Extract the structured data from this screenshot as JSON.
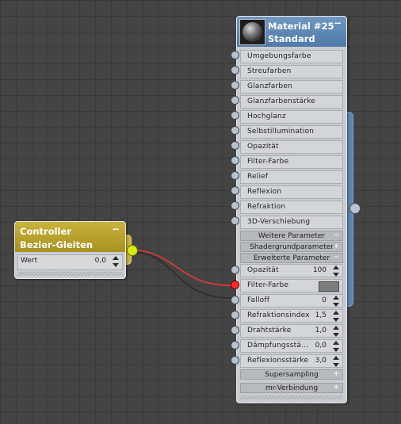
{
  "controller": {
    "title_line1": "Controller",
    "title_line2": "Bezier-Gleiten",
    "collapse_symbol": "−",
    "param_label": "Wert",
    "param_value": "0,0",
    "accent_color": "#c9b23c",
    "output_socket_color": "#d8ea17"
  },
  "material": {
    "title_line1": "Material #25",
    "title_line2": "Standard",
    "collapse_symbol": "−",
    "header_color": "#5f89b6",
    "maps": [
      "Umgebungsfarbe",
      "Streufarben",
      "Glanzfarben",
      "Glanzfarbenstärke",
      "Hochglanz",
      "Selbstillumination",
      "Opazität",
      "Filter-Farbe",
      "Relief",
      "Reflexion",
      "Refraktion",
      "3D-Verschiebung"
    ],
    "rollouts": {
      "weitere": {
        "label": "Weitere Parameter",
        "symbol": "−"
      },
      "shadergrund": {
        "label": "Shadergrundparameter",
        "symbol": "+"
      },
      "erweiterte": {
        "label": "Erweiterte Parameter",
        "symbol": "−"
      },
      "supersampling": {
        "label": "Supersampling",
        "symbol": "+"
      },
      "mr": {
        "label": "mr-Verbindung",
        "symbol": "+"
      }
    },
    "extended_params": [
      {
        "label": "Opazität",
        "value": "100"
      },
      {
        "label": "Filter-Farbe",
        "swatch_color": "#7d7d7d"
      },
      {
        "label": "Falloff",
        "value": "0"
      },
      {
        "label": "Refraktionsindex",
        "value": "1,5"
      },
      {
        "label": "Drahtstärke",
        "value": "1,0"
      },
      {
        "label": "Dämpfungsstä...",
        "value": "0,0"
      },
      {
        "label": "Reflexionsstärke",
        "value": "3,0"
      }
    ]
  },
  "wire": {
    "color": "#e23b3b"
  }
}
